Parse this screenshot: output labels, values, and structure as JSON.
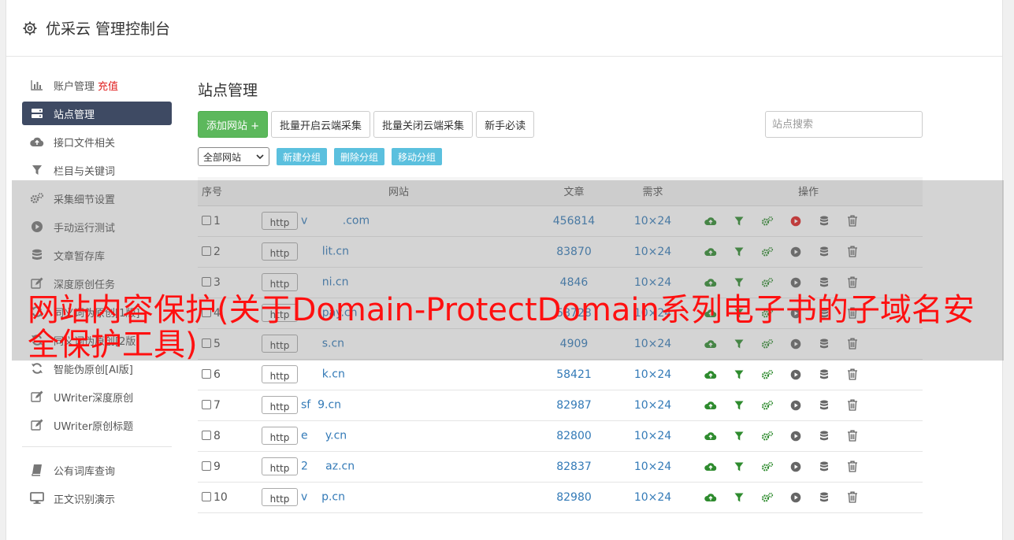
{
  "header": {
    "title": "优采云 管理控制台"
  },
  "sidebar": {
    "items": [
      {
        "label": "账户管理",
        "extra": "充值",
        "icon": "bar-chart-icon"
      },
      {
        "label": "站点管理",
        "icon": "server-icon",
        "active": true
      },
      {
        "label": "接口文件相关",
        "icon": "cloud-upload-icon"
      },
      {
        "label": "栏目与关键词",
        "icon": "filter-icon"
      },
      {
        "label": "采集细节设置",
        "icon": "gears-icon"
      },
      {
        "label": "手动运行测试",
        "icon": "play-circle-icon"
      },
      {
        "label": "文章暂存库",
        "icon": "database-icon"
      },
      {
        "label": "深度原创任务",
        "icon": "edit-icon"
      },
      {
        "label": "同义词伪原创[1版]",
        "icon": "refresh-icon"
      },
      {
        "label": "同义词伪原创[2版]",
        "icon": "refresh-icon"
      },
      {
        "label": "智能伪原创[AI版]",
        "icon": "refresh-icon"
      },
      {
        "label": "UWriter深度原创",
        "icon": "edit-icon"
      },
      {
        "label": "UWriter原创标题",
        "icon": "edit-icon"
      }
    ],
    "bottom_items": [
      {
        "label": "公有词库查询",
        "icon": "book-icon"
      },
      {
        "label": "正文识别演示",
        "icon": "monitor-icon"
      }
    ]
  },
  "main": {
    "title": "站点管理",
    "toolbar": {
      "add_site": "添加网站 +",
      "batch_open": "批量开启云端采集",
      "batch_close": "批量关闭云端采集",
      "newbie": "新手必读",
      "search_placeholder": "站点搜索"
    },
    "group_bar": {
      "select_value": "全部网站",
      "new_group": "新建分组",
      "delete_group": "删除分组",
      "move_group": "移动分组"
    },
    "table": {
      "headers": {
        "no": "序号",
        "site": "网站",
        "articles": "文章",
        "demand": "需求",
        "ops": "操作"
      },
      "rows": [
        {
          "no": "1",
          "scheme": "http",
          "domain": "v          .com",
          "articles": "456814",
          "demand": "10×24",
          "run_active": true
        },
        {
          "no": "2",
          "scheme": "http",
          "domain": "      lit.cn",
          "articles": "83870",
          "demand": "10×24"
        },
        {
          "no": "3",
          "scheme": "http",
          "domain": "      ni.cn",
          "articles": "4846",
          "demand": "10×24"
        },
        {
          "no": "4",
          "scheme": "http",
          "domain": "      pay.cn",
          "articles": "58728",
          "demand": "10×24"
        },
        {
          "no": "5",
          "scheme": "http",
          "domain": "      s.cn",
          "articles": "4909",
          "demand": "10×24"
        },
        {
          "no": "6",
          "scheme": "http",
          "domain": "      k.cn",
          "articles": "58421",
          "demand": "10×24"
        },
        {
          "no": "7",
          "scheme": "http",
          "domain": "sf  9.cn",
          "articles": "82987",
          "demand": "10×24"
        },
        {
          "no": "8",
          "scheme": "http",
          "domain": "e     y.cn",
          "articles": "82800",
          "demand": "10×24"
        },
        {
          "no": "9",
          "scheme": "http",
          "domain": "2     az.cn",
          "articles": "82837",
          "demand": "10×24"
        },
        {
          "no": "10",
          "scheme": "http",
          "domain": "v    p.cn",
          "articles": "82980",
          "demand": "10×24"
        }
      ]
    }
  },
  "watermark": "网站内容保护(关于Domain-ProtectDomain系列电子书的子域名安全保护工具)",
  "colors": {
    "accent_green": "#5cb85c",
    "info_blue": "#5bc0de",
    "link_blue": "#337ab7",
    "sidebar_active": "#3e4a63",
    "watermark_red": "#ff1010"
  }
}
